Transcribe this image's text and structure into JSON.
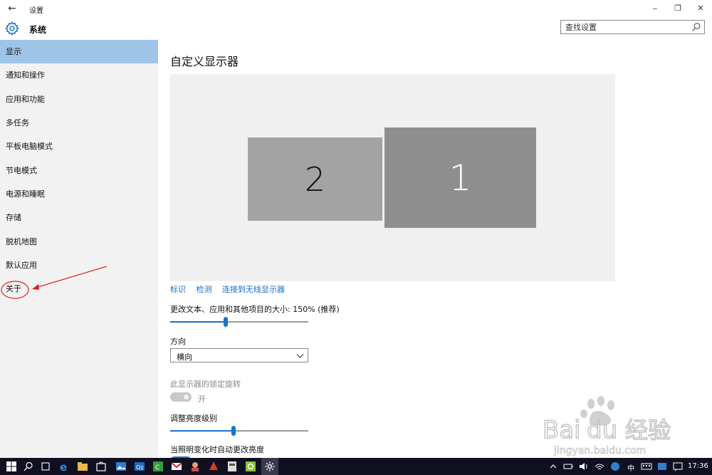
{
  "window": {
    "title": "设置",
    "app_heading": "系统",
    "controls": {
      "minimize": "‒",
      "restore": "❐",
      "close": "✕"
    }
  },
  "search": {
    "placeholder": "查找设置"
  },
  "sidebar": {
    "items": [
      {
        "label": "显示",
        "selected": true
      },
      {
        "label": "通知和操作",
        "selected": false
      },
      {
        "label": "应用和功能",
        "selected": false
      },
      {
        "label": "多任务",
        "selected": false
      },
      {
        "label": "平板电脑模式",
        "selected": false
      },
      {
        "label": "节电模式",
        "selected": false
      },
      {
        "label": "电源和睡眠",
        "selected": false
      },
      {
        "label": "存储",
        "selected": false
      },
      {
        "label": "脱机地图",
        "selected": false
      },
      {
        "label": "默认应用",
        "selected": false
      },
      {
        "label": "关于",
        "selected": false
      }
    ]
  },
  "main": {
    "title": "自定义显示器",
    "monitors": {
      "secondary": "2",
      "primary": "1"
    },
    "links": {
      "identify": "标识",
      "detect": "检测",
      "connect_wireless": "连接到无线显示器"
    },
    "scale": {
      "label": "更改文本、应用和其他项目的大小: 150% (推荐)",
      "level": 0.4
    },
    "orientation": {
      "label": "方向",
      "value": "横向"
    },
    "rotation_lock": {
      "label": "此显示器的锁定旋转",
      "state": "开"
    },
    "brightness": {
      "label": "调整亮度级别",
      "level": 0.46
    },
    "auto_brightness": {
      "label": "当照明变化时自动更改亮度"
    }
  },
  "watermark": {
    "brand": "Baidu经验",
    "url": "jingyan.baidu.com"
  },
  "taskbar": {
    "ime": "中",
    "time": "17:36"
  },
  "colors": {
    "selected_nav": "#9ec4e8",
    "accent": "#1a73c8",
    "link": "#1a6fc4",
    "annotation": "#e02020",
    "taskbar": "#101020"
  }
}
